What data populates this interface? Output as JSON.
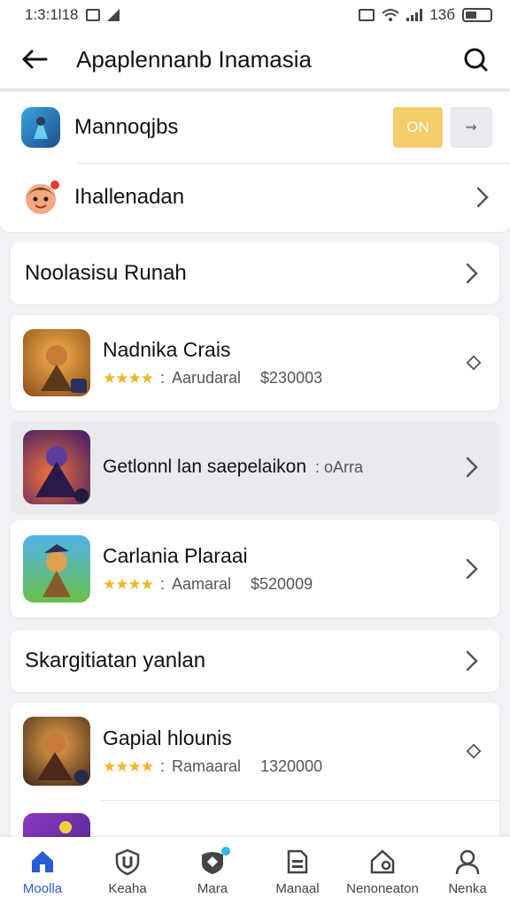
{
  "status_bar": {
    "time": "1:3:1l18",
    "right": "13б"
  },
  "app_bar": {
    "title": "Apaplennanb Inamasia"
  },
  "top_card": {
    "row1_label": "Mannoqjbs",
    "toggle_on_label": "ON",
    "toggle_off_label": "⇝",
    "row2_label": "Ihallenadan"
  },
  "section1": {
    "label": "Noolasisu Runah"
  },
  "games": [
    {
      "title": "Nadnika Crais",
      "stars": "★★★★",
      "category": "Aarudaral",
      "price": "$230003"
    },
    {
      "title": "Getlonnl lan saepelaikon",
      "suffix": ": oArra"
    },
    {
      "title": "Carlania Plaraai",
      "stars": "★★★★",
      "category": "Aamaral",
      "price": "$520009"
    }
  ],
  "section2": {
    "label": "Skargitiatan yanlan"
  },
  "games2": [
    {
      "title": "Gapial hlounis",
      "stars": "★★★★",
      "category": "Ramaaral",
      "price": "1320000"
    }
  ],
  "nav": [
    {
      "label": "Moolla",
      "icon": "home-icon"
    },
    {
      "label": "Keaha",
      "icon": "shield-icon"
    },
    {
      "label": "Mara",
      "icon": "diamond-badge-icon"
    },
    {
      "label": "Manaal",
      "icon": "document-icon"
    },
    {
      "label": "Nenoneaton",
      "icon": "notification-home-icon"
    },
    {
      "label": "Nenka",
      "icon": "person-icon"
    }
  ],
  "colors": {
    "accent": "#2a5bd7",
    "toggle_on": "#f5cd6a",
    "star": "#f0b722",
    "badge": "#2fb8ee"
  }
}
